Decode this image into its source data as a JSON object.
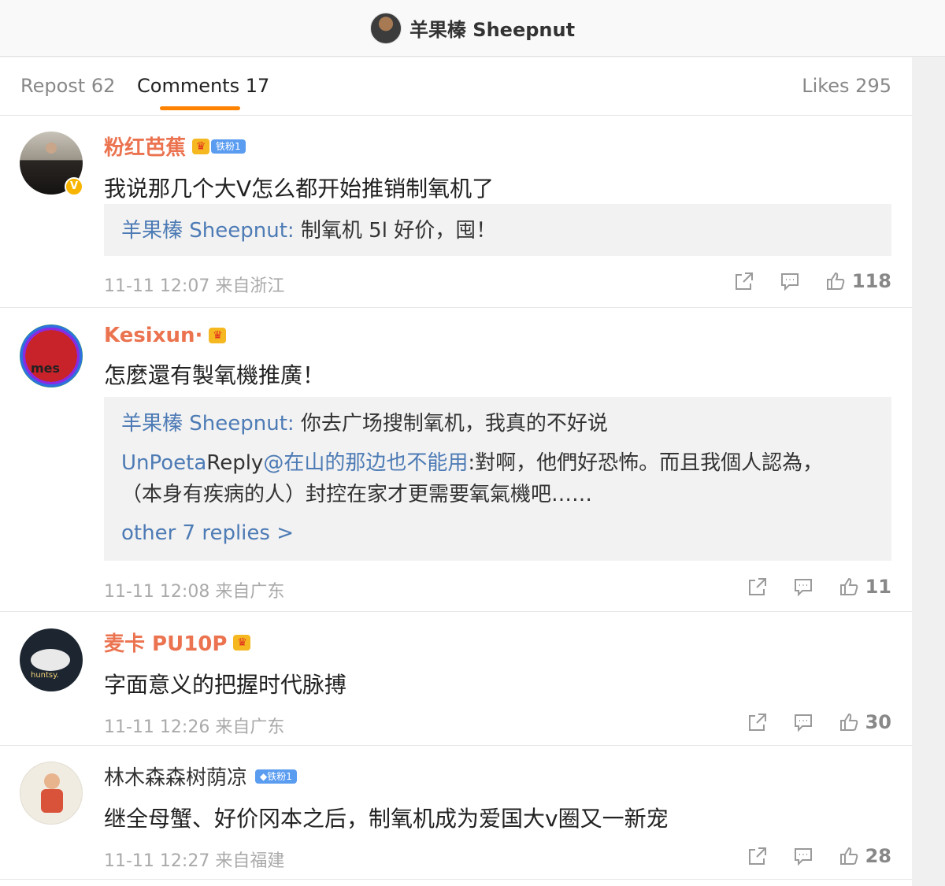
{
  "header": {
    "title": "羊果榛 Sheepnut",
    "avatar_icon": "profile-avatar"
  },
  "tabs": {
    "repost": "Repost 62",
    "comments": "Comments 17",
    "likes": "Likes 295",
    "active_color": "#ff8200"
  },
  "comments": [
    {
      "name": "粉红芭蕉",
      "badge": "铁粉1",
      "text": "我说那几个大Ⅴ怎么都开始推销制氧机了",
      "replies": [
        {
          "who": "羊果榛 Sheepnut:",
          "text": " 制氧机 5l 好价，囤！"
        }
      ],
      "time": "11-11 12:07 来自浙江",
      "likes": "118"
    },
    {
      "name": "Kesixun·",
      "text": "怎麼還有製氧機推廣！",
      "replies": [
        {
          "who": "羊果榛 Sheepnut:",
          "text": " 你去广场搜制氧机，我真的不好说"
        },
        {
          "who": "UnPoeta",
          "mid": "Reply",
          "who2": "@在山的那边也不能用",
          "text": ":對啊，他們好恐怖。而且我個人認為，",
          "text2": "（本身有疾病的人）封控在家才更需要氧氣機吧……"
        }
      ],
      "more": "other 7 replies >",
      "time": "11-11 12:08 来自广东",
      "likes": "11"
    },
    {
      "name": "麦卡 PU10P",
      "text": "字面意义的把握时代脉搏",
      "time": "11-11 12:26 来自广东",
      "likes": "30",
      "avatar_text": "huntsy."
    },
    {
      "name": "林木森森树荫凉",
      "badge": "铁粉1",
      "text": "继全母蟹、好价冈本之后，制氧机成为爱国大v圈又一新宠",
      "time": "11-11 12:27 来自福建",
      "likes": "28"
    }
  ],
  "avatar_texts": {
    "c2": "mes"
  },
  "colors": {
    "name_orange": "#eb7350",
    "link_blue": "#4d7bb5",
    "meta_gray": "#aaaaaa"
  }
}
